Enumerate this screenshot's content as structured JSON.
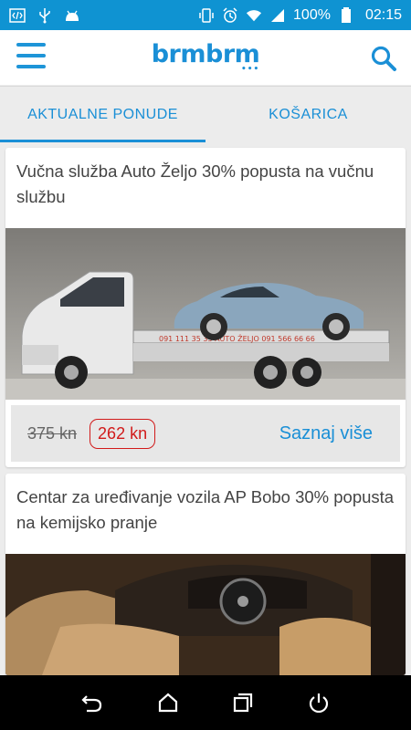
{
  "status_bar": {
    "battery": "100%",
    "time": "02:15",
    "icons": [
      "code-icon",
      "usb-icon",
      "android-icon",
      "vibrate-icon",
      "alarm-icon",
      "wifi-icon",
      "signal-icon",
      "battery-icon"
    ]
  },
  "app_bar": {
    "logo_text": "brmbrm",
    "logo_dots": "•••",
    "menu_icon": "hamburger-icon",
    "search_icon": "search-icon",
    "accent": "#1a8fd6"
  },
  "tabs": [
    {
      "label": "AKTUALNE PONUDE",
      "active": true
    },
    {
      "label": "KOŠARICA",
      "active": false
    }
  ],
  "offers": [
    {
      "title": "Vučna služba Auto Željo 30% popusta na vučnu službu",
      "image": "tow-truck-with-convertible",
      "truck_sign": "091 111 35 33   AUTO ŽELJO   091 566 66 66",
      "old_price": "375 kn",
      "new_price": "262 kn",
      "action": "Saznaj više"
    },
    {
      "title": "Centar za uređivanje vozila AP Bobo 30% popusta na kemijsko pranje",
      "image": "car-interior-leather"
    }
  ],
  "nav_bar": [
    "back-icon",
    "home-icon",
    "recents-icon",
    "power-icon"
  ],
  "colors": {
    "status_bar": "#0f93d2",
    "price_red": "#d11a1a"
  }
}
